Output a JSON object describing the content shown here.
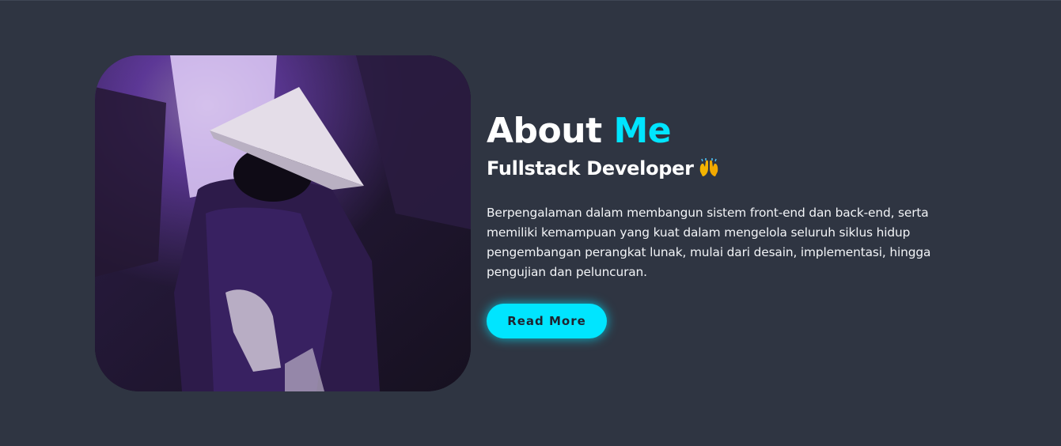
{
  "about": {
    "heading_prefix": "About",
    "heading_accent": "Me",
    "subtitle": "Fullstack Developer",
    "subtitle_icon": "raised-hands-icon",
    "description": "Berpengalaman dalam membangun sistem front-end dan back-end, serta memiliki kemampuan yang kuat dalam mengelola seluruh siklus hidup pengembangan perangkat lunak, mulai dari desain, implementasi, hingga pengujian dan peluncuran.",
    "button_label": "Read More",
    "image_icon": "profile-photo"
  },
  "colors": {
    "background": "#2f3542",
    "accent": "#00e5ff",
    "text": "#ffffff",
    "photo_tint": "#6a2fc7"
  }
}
